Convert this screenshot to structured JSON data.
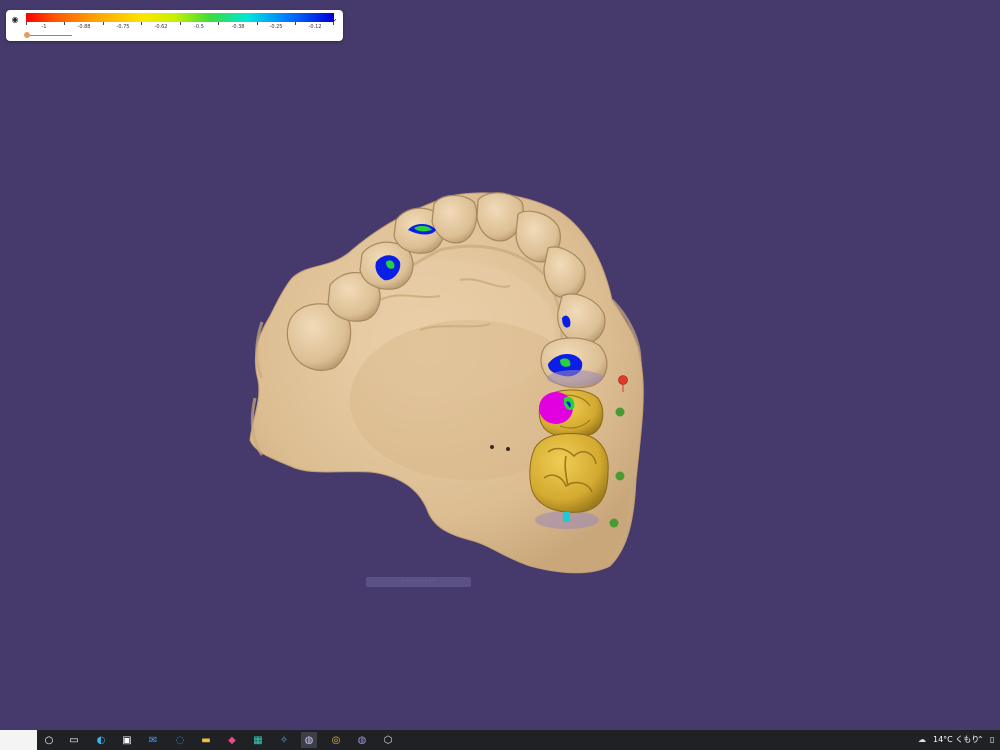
{
  "legend": {
    "labels": [
      "-1",
      "-0.88",
      "-0.75",
      "-0.62",
      "-0.5",
      "-0.38",
      "-0.25",
      "-0.12"
    ],
    "eye_icon": "eye-icon",
    "chevron_icon": "chevron-down-icon"
  },
  "colors": {
    "background": "#463a6d",
    "model": "#e3c69d",
    "crown": "#d7b13a",
    "contact_blue": "#0a1ee6",
    "contact_green": "#26d13c",
    "contact_magenta": "#e000e0",
    "marker_red": "#e03a2a",
    "marker_green": "#4a9a34"
  },
  "taskbar": {
    "apps": [
      "search-box",
      "cortana-icon",
      "task-view-icon",
      "edge-icon",
      "store-icon",
      "mail-icon",
      "app-icon",
      "file-explorer-icon",
      "paint-icon",
      "app-icon",
      "app-icon",
      "cad-app-icon",
      "chrome-icon",
      "cad-app-icon",
      "box-icon"
    ],
    "weather_icon": "cloud-icon",
    "weather_text": "14°C くもり",
    "tray_chevron": "chevron-up-icon"
  }
}
